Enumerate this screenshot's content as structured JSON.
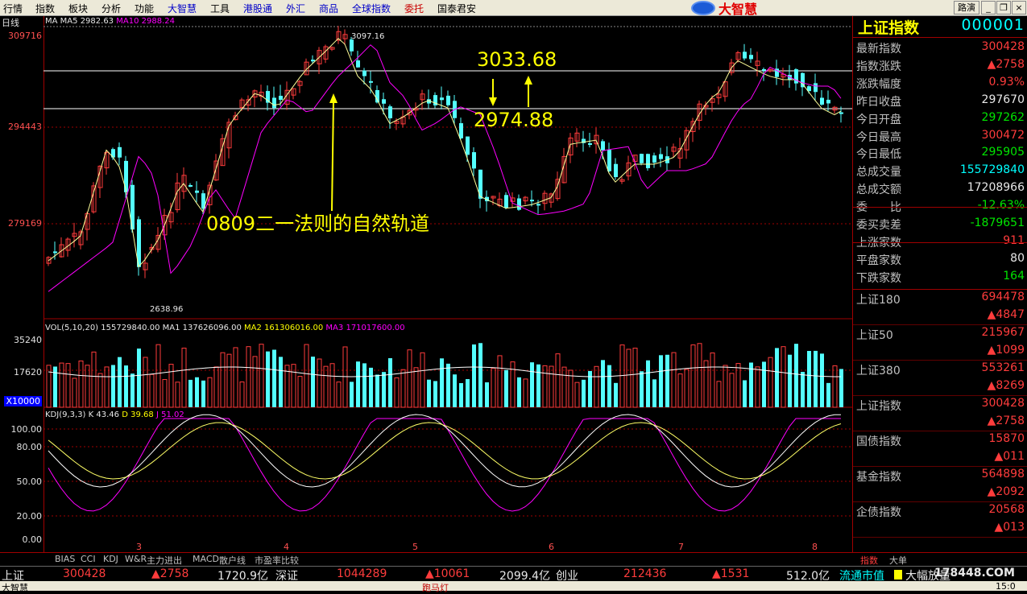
{
  "menu": {
    "items": [
      "行情",
      "指数",
      "板块",
      "分析",
      "功能",
      "大智慧",
      "工具",
      "港股通",
      "外汇",
      "商品",
      "全球指数",
      "委托",
      "国泰君安"
    ],
    "logo_text": "大智慧",
    "route_btn": "路演"
  },
  "main_chart": {
    "period": "日线",
    "ma_info_prefix": "MA",
    "ma5_label": "MA5",
    "ma5_value": "2982.63",
    "ma10_label": "MA10",
    "ma10_value": "2988.24",
    "y_labels": [
      "309716",
      "294443",
      "279169"
    ],
    "high_label": "3097.16",
    "low_label": "2638.96",
    "annotation_upper": "3033.68",
    "annotation_lower": "2974.88",
    "annotation_main": "0809二一法则的自然轨道"
  },
  "volume": {
    "title": "VOL(5,10,20)",
    "vol_value": "155729840.00",
    "ma1_label": "MA1",
    "ma1_value": "137626096.00",
    "ma2_label": "MA2",
    "ma2_value": "161306016.00",
    "ma3_label": "MA3",
    "ma3_value": "171017600.00",
    "y_labels": [
      "35240",
      "17620"
    ],
    "unit": "X10000"
  },
  "kdj": {
    "title": "KDJ(9,3,3)",
    "k_label": "K",
    "k_value": "43.46",
    "d_label": "D",
    "d_value": "39.68",
    "j_label": "J",
    "j_value": "51.02",
    "y_labels": [
      "100.00",
      "80.00",
      "50.00",
      "20.00",
      "0.00"
    ],
    "x_labels": [
      "3",
      "4",
      "5",
      "6",
      "7",
      "8"
    ]
  },
  "right_panel": {
    "title": "上证指数",
    "code": "000001",
    "rows": [
      {
        "label": "最新指数",
        "value": "300428",
        "color": "red"
      },
      {
        "label": "指数涨跌",
        "value": "▲2758",
        "color": "red"
      },
      {
        "label": "涨跌幅度",
        "value": "0.93%",
        "color": "red"
      },
      {
        "label": "昨日收盘",
        "value": "297670",
        "color": "white"
      },
      {
        "label": "今日开盘",
        "value": "297262",
        "color": "green"
      },
      {
        "label": "今日最高",
        "value": "300472",
        "color": "red"
      },
      {
        "label": "今日最低",
        "value": "295905",
        "color": "green"
      },
      {
        "label": "总成交量",
        "value": "155729840",
        "color": "cyan"
      },
      {
        "label": "总成交额",
        "value": "17208966",
        "color": "white"
      },
      {
        "label": "委　　比",
        "value": "-12.63%",
        "color": "green"
      },
      {
        "label": "委买卖差",
        "value": "-1879651",
        "color": "green"
      },
      {
        "label": "上涨家数",
        "value": "911",
        "color": "red"
      },
      {
        "label": "平盘家数",
        "value": "80",
        "color": "white"
      },
      {
        "label": "下跌家数",
        "value": "164",
        "color": "green"
      }
    ],
    "indices": [
      {
        "name": "上证180",
        "value": "694478",
        "change": "▲4847"
      },
      {
        "name": "上证50",
        "value": "215967",
        "change": "▲1099"
      },
      {
        "name": "上证380",
        "value": "553261",
        "change": "▲8269"
      },
      {
        "name": "上证指数",
        "value": "300428",
        "change": "▲2758"
      },
      {
        "name": "国债指数",
        "value": "15870",
        "change": "▲011"
      },
      {
        "name": "基金指数",
        "value": "564898",
        "change": "▲2092"
      },
      {
        "name": "企债指数",
        "value": "20568",
        "change": "▲013"
      }
    ]
  },
  "tabs": [
    "BIAS",
    "CCI",
    "KDJ",
    "W&R",
    "主力进出",
    "MACD",
    "散户线",
    "市盈率比较"
  ],
  "right_tabs": [
    "指数",
    "大单"
  ],
  "status": {
    "sh_label": "上证",
    "sh_value": "300428",
    "sh_change": "▲2758",
    "sh_amount": "1720.9亿",
    "sz_label": "深证",
    "sz_value": "1044289",
    "sz_change": "▲10061",
    "sz_amount": "2099.4亿",
    "cy_label": "创业",
    "cy_value": "212436",
    "cy_change": "▲1531",
    "cy_amount": "512.0亿",
    "flow_label": "流通市值",
    "big_label": "大幅放量",
    "watermark": "178448.COM",
    "bottom_left": "大智慧",
    "bottom_mid": "跑马灯",
    "bottom_right": "15:0"
  },
  "colors": {
    "up": "#ff3c3c",
    "down": "#54ffff",
    "ma5": "#ffff99",
    "ma10": "#ff00ff",
    "k": "#ffffff",
    "d": "#ffff66",
    "j": "#ff00ff"
  }
}
